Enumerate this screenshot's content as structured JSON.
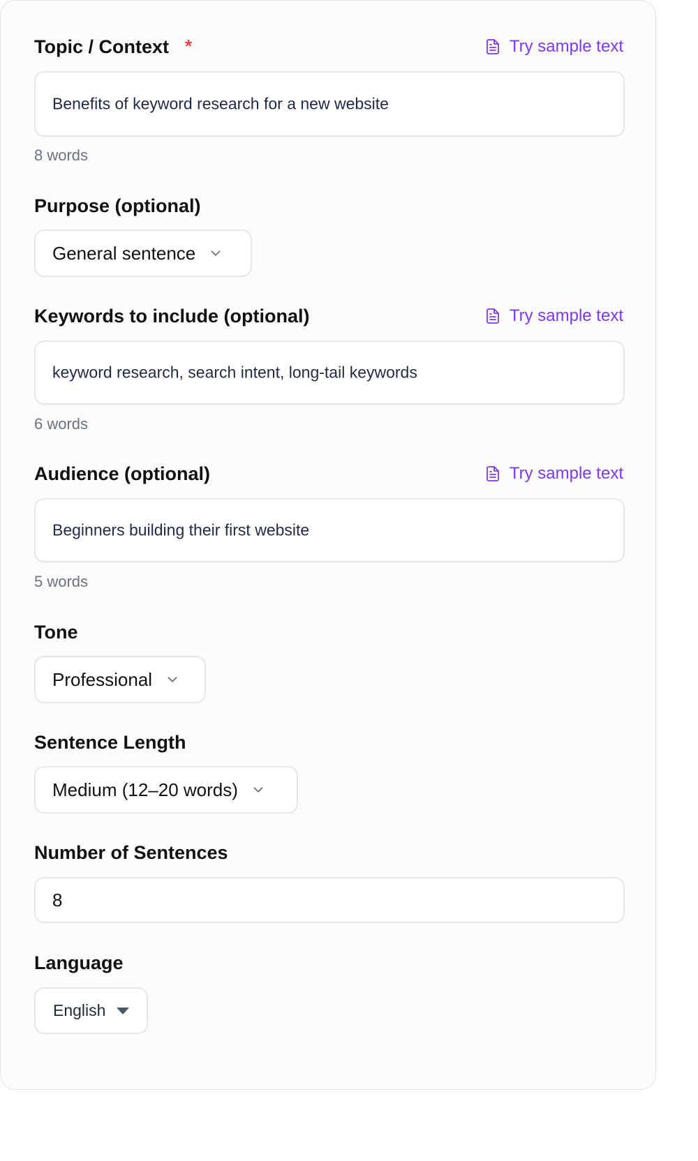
{
  "topic": {
    "label": "Topic / Context",
    "required_mark": "*",
    "sample_link": "Try sample text",
    "value": "Benefits of keyword research for a new website",
    "word_count": "8 words"
  },
  "purpose": {
    "label": "Purpose (optional)",
    "selected": "General sentence"
  },
  "keywords": {
    "label": "Keywords to include (optional)",
    "sample_link": "Try sample text",
    "value": "keyword research, search intent, long-tail keywords",
    "word_count": "6 words"
  },
  "audience": {
    "label": "Audience (optional)",
    "sample_link": "Try sample text",
    "value": "Beginners building their first website",
    "word_count": "5 words"
  },
  "tone": {
    "label": "Tone",
    "selected": "Professional"
  },
  "sentence_length": {
    "label": "Sentence Length",
    "selected": "Medium (12–20 words)"
  },
  "number_of_sentences": {
    "label": "Number of Sentences",
    "value": "8"
  },
  "language": {
    "label": "Language",
    "selected": "English"
  },
  "colors": {
    "accent": "#7c3aed",
    "required": "#ef4444",
    "muted_text": "#6b7280",
    "border": "#e5e7eb"
  },
  "icons": {
    "sample_link_icon": "document-icon",
    "select_icon": "chevron-down-icon",
    "language_select_icon": "caret-down-icon"
  }
}
